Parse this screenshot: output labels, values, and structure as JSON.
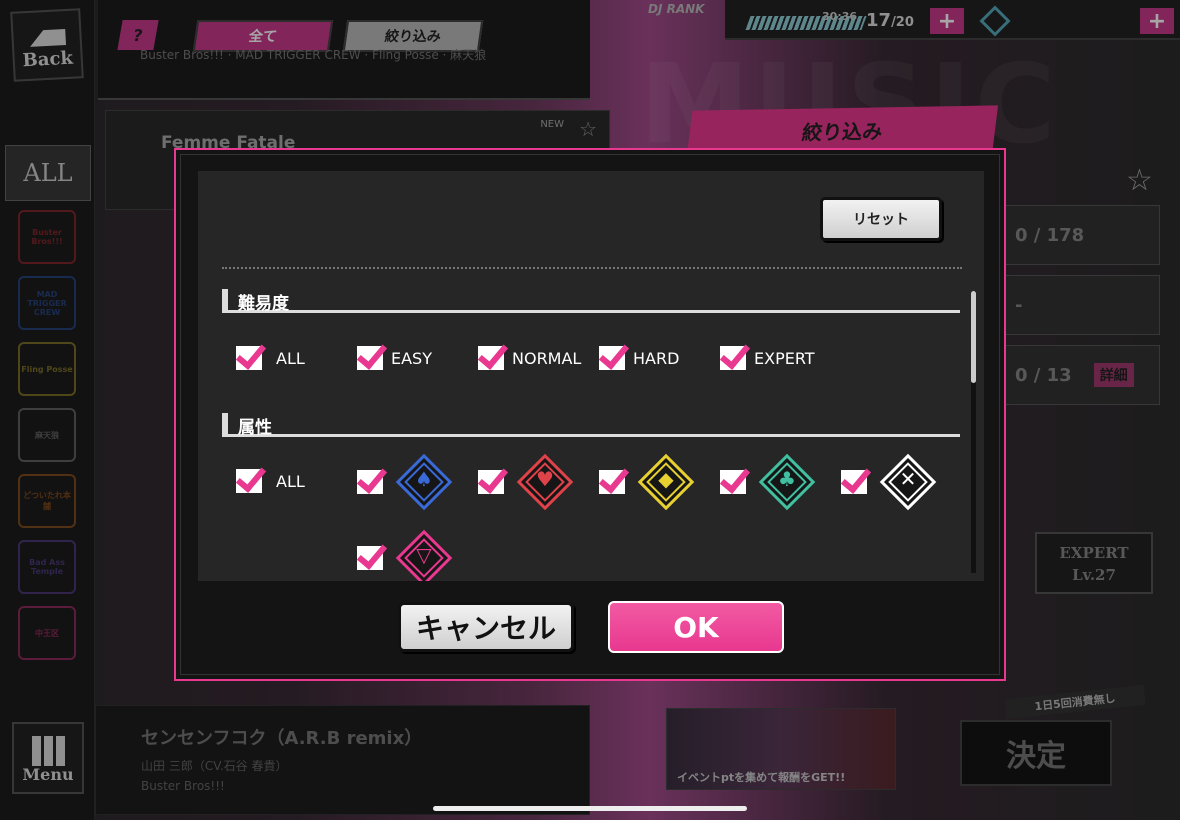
{
  "app": {
    "back_label": "Back",
    "menu_label": "Menu",
    "all_tab": "ALL",
    "help_label": "?",
    "tabs": {
      "all": "全て",
      "filter": "絞り込み"
    },
    "song_sub": "Buster Bros!!! · MAD TRIGGER CREW · Fling Posse · 麻天狼",
    "bg_word": "MUSIC"
  },
  "divisions": [
    {
      "name": "Buster Bros!!!",
      "color": "#d0303a"
    },
    {
      "name": "MAD TRIGGER CREW",
      "color": "#3060c8"
    },
    {
      "name": "Fling Posse",
      "color": "#c8b030"
    },
    {
      "name": "麻天狼",
      "color": "#999999"
    },
    {
      "name": "どついたれ本舗",
      "color": "#d07020"
    },
    {
      "name": "Bad Ass Temple",
      "color": "#7050c0"
    },
    {
      "name": "中王区",
      "color": "#e8388f"
    }
  ],
  "song_list": {
    "card_title": "Femme Fatale",
    "new_badge": "NEW",
    "bottom_title": "センセンフコク（A.R.B remix）",
    "bottom_artist": "山田 三郎（CV.石谷 春貴）",
    "bottom_group": "Buster Bros!!!"
  },
  "status": {
    "dj_rank": "DJ RANK",
    "timer": "30:36",
    "stamina_current": "17",
    "stamina_max": "/20",
    "plus": "+"
  },
  "right_panel": {
    "header": "絞り込み",
    "count": "0 / 178",
    "dash": "-",
    "progress": "0 / 13",
    "detail": "詳細",
    "expert": "EXPERT",
    "level": "Lv.27",
    "banner_text": "イベントptを集めて報酬をGET!!",
    "daily": "1日5回消費無し",
    "decide": "決定"
  },
  "modal": {
    "reset_label": "リセット",
    "difficulty_title": "難易度",
    "difficulty_options": [
      {
        "label": "ALL",
        "checked": true
      },
      {
        "label": "EASY",
        "checked": true
      },
      {
        "label": "NORMAL",
        "checked": true
      },
      {
        "label": "HARD",
        "checked": true
      },
      {
        "label": "EXPERT",
        "checked": true
      }
    ],
    "attribute_title": "属性",
    "attribute_all_label": "ALL",
    "attribute_icons": [
      {
        "icon": "spade-icon",
        "color": "#3a6ad8",
        "symbol": "♠"
      },
      {
        "icon": "heart-icon",
        "color": "#e0424a",
        "symbol": "♥"
      },
      {
        "icon": "diamond-icon",
        "color": "#e8d030",
        "symbol": "◆"
      },
      {
        "icon": "club-icon",
        "color": "#40c0a0",
        "symbol": "♣"
      },
      {
        "icon": "microphone-icon",
        "color": "#ffffff",
        "symbol": "✕"
      },
      {
        "icon": "chuoku-icon",
        "color": "#e8388f",
        "symbol": "▽"
      }
    ],
    "cancel_label": "キャンセル",
    "ok_label": "OK"
  }
}
